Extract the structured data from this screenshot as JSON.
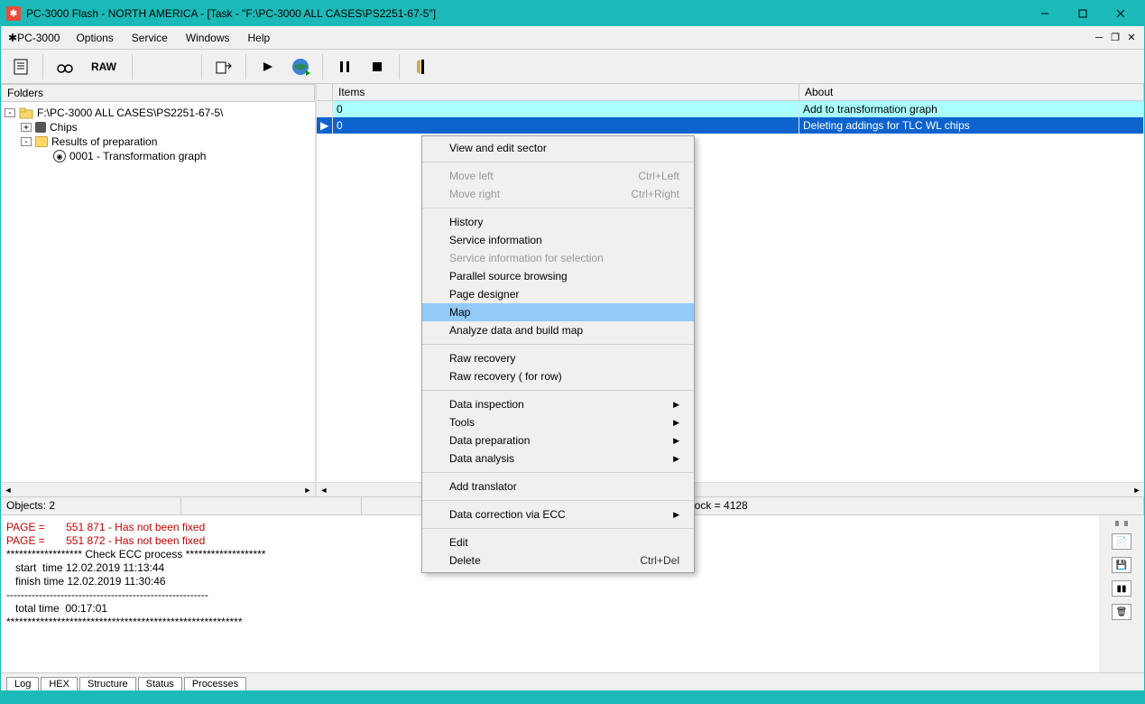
{
  "title": "PC-3000 Flash - NORTH AMERICA - [Task - \"F:\\PC-3000 ALL CASES\\PS2251-67-5\"]",
  "menubar": {
    "app": "PC-3000",
    "options": "Options",
    "service": "Service",
    "windows": "Windows",
    "help": "Help"
  },
  "toolbar": {
    "raw": "RAW"
  },
  "left_header": "Folders",
  "tree": {
    "root": "F:\\PC-3000 ALL CASES\\PS2251-67-5\\",
    "chips": "Chips",
    "results": "Results of preparation",
    "graph": "0001 - Transformation graph"
  },
  "table": {
    "col_items": "Items",
    "col_about": "About",
    "rows": [
      {
        "item": "0",
        "about": "Add to transformation graph"
      },
      {
        "item": "0",
        "about": "Deleting addings for TLC WL chips"
      }
    ]
  },
  "status": {
    "objects": "Objects: 2",
    "lock_hidden": "lock = 4128"
  },
  "log": {
    "l1": "PAGE =       551 871 - Has not been fixed",
    "l2": "PAGE =       551 872 - Has not been fixed",
    "l3": "****************** Check ECC process *******************",
    "l4": "   start  time 12.02.2019 11:13:44",
    "l5": "   finish time 12.02.2019 11:30:46",
    "l6": "--------------------------------------------------------",
    "l7": "   total time  00:17:01",
    "l8": "********************************************************"
  },
  "tabs": {
    "log": "Log",
    "hex": "HEX",
    "structure": "Structure",
    "status": "Status",
    "processes": "Processes"
  },
  "context": {
    "view_edit": "View and edit sector",
    "move_left": "Move left",
    "move_left_sc": "Ctrl+Left",
    "move_right": "Move right",
    "move_right_sc": "Ctrl+Right",
    "history": "History",
    "service_info": "Service information",
    "service_info_sel": "Service information for selection",
    "parallel": "Parallel source browsing",
    "page_designer": "Page designer",
    "map": "Map",
    "analyze": "Analyze data and build map",
    "raw_recovery": "Raw recovery",
    "raw_recovery_row": "Raw recovery ( for row)",
    "data_inspection": "Data inspection",
    "tools": "Tools",
    "data_prep": "Data preparation",
    "data_analysis": "Data analysis",
    "add_translator": "Add translator",
    "data_correction": "Data correction via ECC",
    "edit": "Edit",
    "delete": "Delete",
    "delete_sc": "Ctrl+Del"
  }
}
